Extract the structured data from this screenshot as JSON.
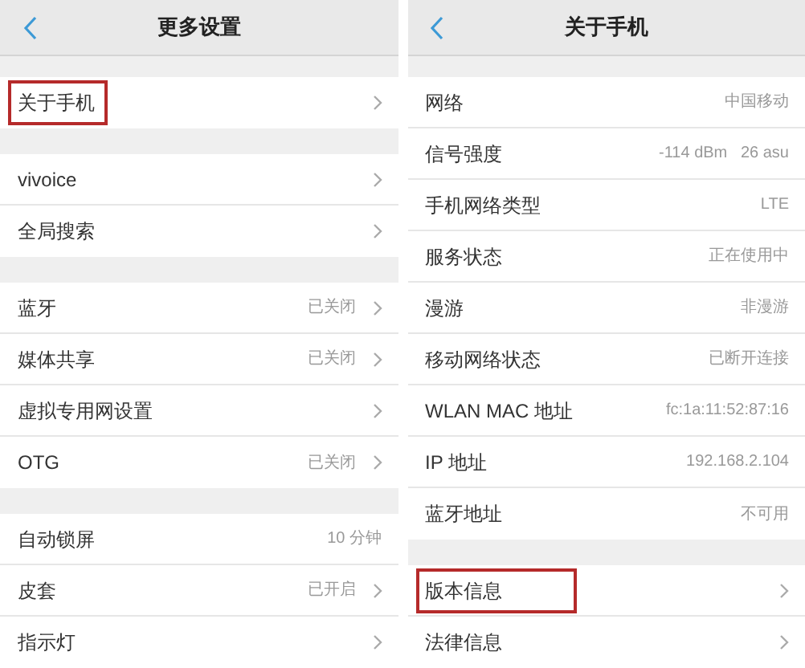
{
  "panels": [
    {
      "title": "更多设置",
      "back": true,
      "groups": [
        {
          "rows": [
            {
              "label": "关于手机",
              "chevron": true,
              "highlighted": true
            }
          ]
        },
        {
          "rows": [
            {
              "label": "vivoice",
              "chevron": true,
              "highlighted": false
            },
            {
              "label": "全局搜索",
              "chevron": true,
              "highlighted": false
            }
          ]
        },
        {
          "rows": [
            {
              "label": "蓝牙",
              "value": "已关闭",
              "chevron": true,
              "highlighted": false
            },
            {
              "label": "媒体共享",
              "value": "已关闭",
              "chevron": true,
              "highlighted": false
            },
            {
              "label": "虚拟专用网设置",
              "chevron": true,
              "highlighted": false
            },
            {
              "label": "OTG",
              "value": "已关闭",
              "chevron": true,
              "highlighted": false
            }
          ]
        },
        {
          "rows": [
            {
              "label": "自动锁屏",
              "value": "10 分钟",
              "chevron": false,
              "highlighted": false
            },
            {
              "label": "皮套",
              "value": "已开启",
              "chevron": true,
              "highlighted": false
            },
            {
              "label": "指示灯",
              "chevron": true,
              "highlighted": false
            }
          ]
        }
      ]
    },
    {
      "title": "关于手机",
      "back": true,
      "groups": [
        {
          "rows": [
            {
              "label": "网络",
              "value": "中国移动",
              "chevron": false,
              "highlighted": false
            },
            {
              "label": "信号强度",
              "value": "-114 dBm   26 asu",
              "chevron": false,
              "highlighted": false
            },
            {
              "label": "手机网络类型",
              "value": "LTE",
              "chevron": false,
              "highlighted": false
            },
            {
              "label": "服务状态",
              "value": "正在使用中",
              "chevron": false,
              "highlighted": false
            },
            {
              "label": "漫游",
              "value": "非漫游",
              "chevron": false,
              "highlighted": false
            },
            {
              "label": "移动网络状态",
              "value": "已断开连接",
              "chevron": false,
              "highlighted": false
            },
            {
              "label": "WLAN MAC 地址",
              "value": "fc:1a:11:52:87:16",
              "chevron": false,
              "highlighted": false
            },
            {
              "label": "IP 地址",
              "value": "192.168.2.104",
              "chevron": false,
              "highlighted": false
            },
            {
              "label": "蓝牙地址",
              "value": "不可用",
              "chevron": false,
              "highlighted": false
            }
          ]
        },
        {
          "rows": [
            {
              "label": "版本信息",
              "chevron": true,
              "highlighted": true
            },
            {
              "label": "法律信息",
              "chevron": true,
              "highlighted": false
            }
          ]
        }
      ]
    }
  ]
}
